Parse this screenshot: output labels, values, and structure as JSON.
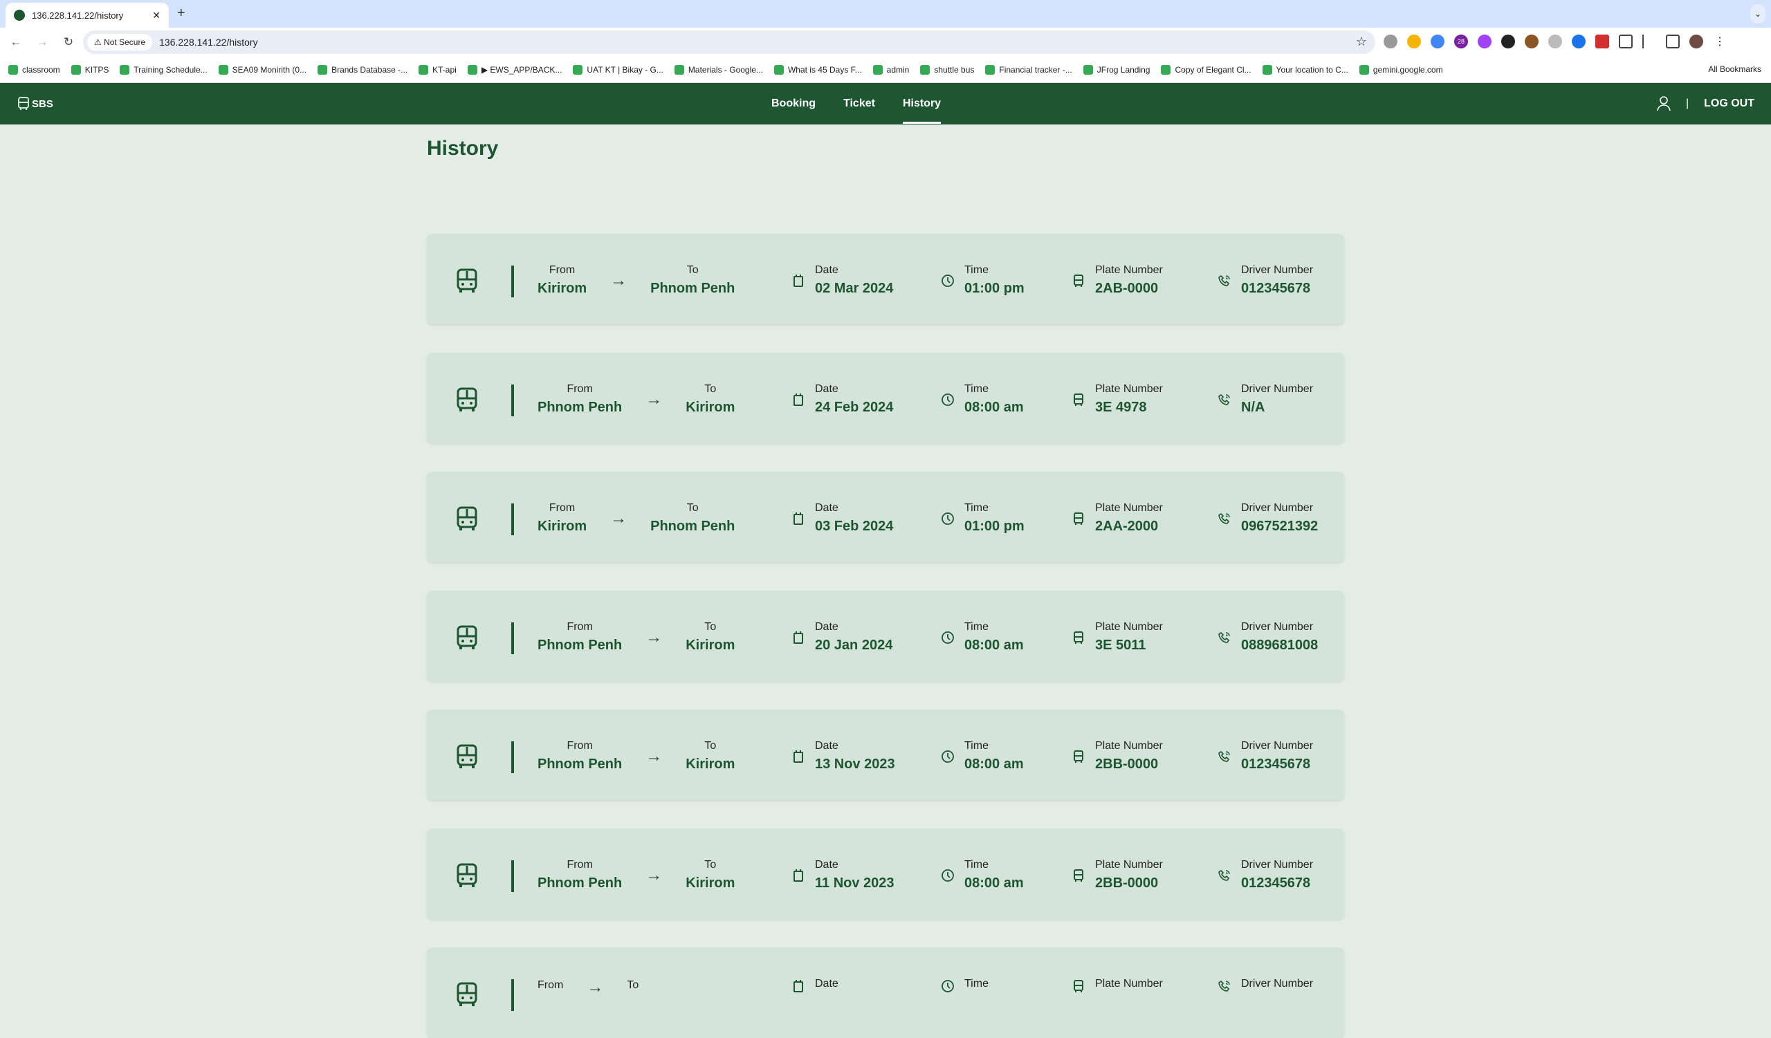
{
  "browser": {
    "tab_title": "136.228.141.22/history",
    "not_secure": "Not Secure",
    "url": "136.228.141.22/history",
    "bookmarks": [
      "classroom",
      "KITPS",
      "Training Schedule...",
      "SEA09 Monirith (0...",
      "Brands Database -...",
      "KT-api",
      "▶ EWS_APP/BACK...",
      "UAT KT | Bikay - G...",
      "Materials - Google...",
      "What is 45 Days F...",
      "admin",
      "shuttle bus",
      "Financial tracker -...",
      "JFrog Landing",
      "Copy of Elegant Cl...",
      "Your location to C...",
      "gemini.google.com"
    ],
    "all_bookmarks": "All Bookmarks",
    "ext_badge": "28"
  },
  "nav": {
    "logo": "SBS",
    "links": [
      "Booking",
      "Ticket",
      "History"
    ],
    "logout": "LOG OUT",
    "separator": "|"
  },
  "page_title": "History",
  "labels": {
    "from": "From",
    "to": "To",
    "date": "Date",
    "time": "Time",
    "plate": "Plate Number",
    "driver": "Driver Number"
  },
  "trips": [
    {
      "from": "Kirirom",
      "to": "Phnom Penh",
      "date": "02 Mar 2024",
      "time": "01:00 pm",
      "plate": "2AB-0000",
      "driver": "012345678"
    },
    {
      "from": "Phnom Penh",
      "to": "Kirirom",
      "date": "24 Feb 2024",
      "time": "08:00 am",
      "plate": "3E 4978",
      "driver": "N/A"
    },
    {
      "from": "Kirirom",
      "to": "Phnom Penh",
      "date": "03 Feb 2024",
      "time": "01:00 pm",
      "plate": "2AA-2000",
      "driver": "0967521392"
    },
    {
      "from": "Phnom Penh",
      "to": "Kirirom",
      "date": "20 Jan 2024",
      "time": "08:00 am",
      "plate": "3E 5011",
      "driver": "0889681008"
    },
    {
      "from": "Phnom Penh",
      "to": "Kirirom",
      "date": "13 Nov 2023",
      "time": "08:00 am",
      "plate": "2BB-0000",
      "driver": "012345678"
    },
    {
      "from": "Phnom Penh",
      "to": "Kirirom",
      "date": "11 Nov 2023",
      "time": "08:00 am",
      "plate": "2BB-0000",
      "driver": "012345678"
    },
    {}
  ]
}
